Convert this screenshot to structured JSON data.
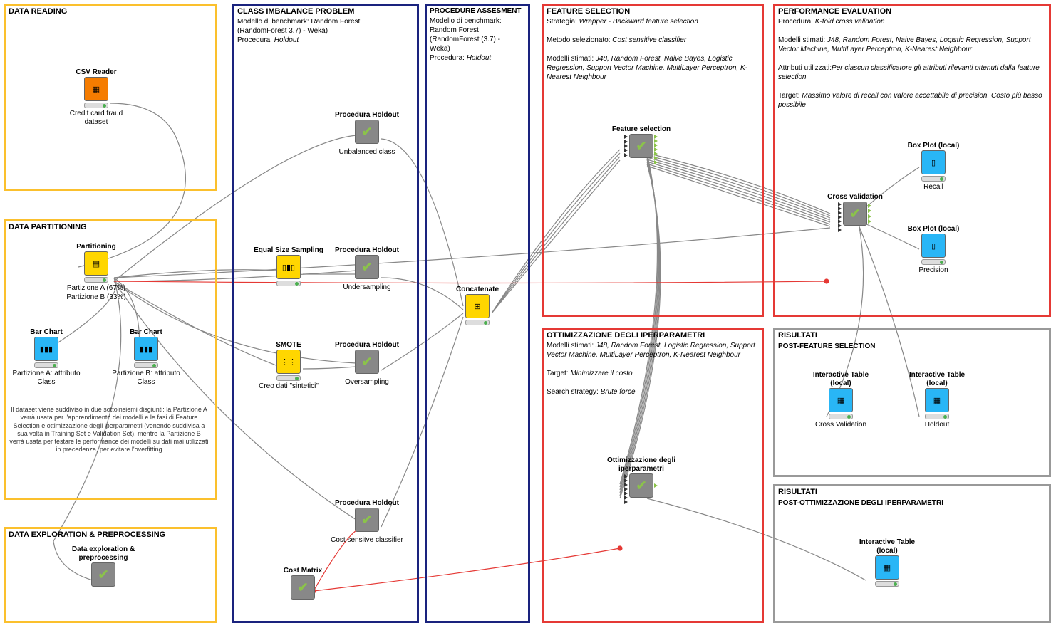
{
  "boxes": {
    "data_reading": {
      "title": "DATA READING"
    },
    "data_partitioning": {
      "title": "DATA PARTITIONING"
    },
    "data_exploration": {
      "title": "DATA EXPLORATION & PREPROCESSING"
    },
    "class_imbalance": {
      "title": "CLASS IMBALANCE PROBLEM",
      "l1": "Modello di benchmark: Random Forest",
      "l2": "(RandomForest 3.7) - Weka)",
      "l3": "Procedura: ",
      "l3i": "Holdout"
    },
    "procedure_assessment": {
      "title": "PROCEDURE ASSESMENT",
      "l1": "Modello di benchmark:",
      "l2": "Random Forest",
      "l3": "(RandomForest (3.7) -",
      "l4": "Weka)",
      "l5": "Procedura: ",
      "l5i": "Holdout"
    },
    "feature_selection": {
      "title": "FEATURE SELECTION",
      "l1": "Strategia: ",
      "l1i": "Wrapper - Backward feature selection",
      "l2": "Metodo selezionato: ",
      "l2i": "Cost sensitive classifier",
      "l3": "Modelli stimati: ",
      "l3i": "J48, Random Forest, Naive Bayes, Logistic Regression, Support Vector Machine, MultiLayer Perceptron, K-Nearest Neighbour"
    },
    "performance_evaluation": {
      "title": "PERFORMANCE EVALUATION",
      "l1": "Procedura: ",
      "l1i": "K-fold cross validation",
      "l2": "Modelli stimati: ",
      "l2i": "J48, Random Forest, Naive Bayes, Logistic Regression, Support Vector Machine, MultiLayer Perceptron, K-Nearest Neighbour",
      "l3": "Attributi utilizzati:",
      "l3i": "Per ciascun classificatore gli attributi rilevanti ottenuti dalla feature selection",
      "l4": "Target: ",
      "l4i": "Massimo valore di recall con valore accettabile di precision. Costo più basso possibile"
    },
    "ottimizzazione": {
      "title": "OTTIMIZZAZIONE DEGLI IPERPARAMETRI",
      "l1": "Modelli stimati: ",
      "l1i": "J48, Random Forest, Logistic Regression, Support Vector Machine, MultiLayer Perceptron, K-Nearest Neighbour",
      "l2": "Target: ",
      "l2i": "Minimizzare il costo",
      "l3": "Search strategy: ",
      "l3i": "Brute force"
    },
    "risultati1": {
      "title": "RISULTATI",
      "sub": "POST-FEATURE SELECTION"
    },
    "risultati2": {
      "title": "RISULTATI",
      "sub": "POST-OTTIMIZZAZIONE DEGLI IPERPARAMETRI"
    }
  },
  "nodes": {
    "csv_reader": {
      "title": "CSV Reader",
      "sub": "Credit card fraud dataset"
    },
    "partitioning": {
      "title": "Partitioning",
      "sub1": "Partizione A (67%)",
      "sub2": "Partizione B (33%)"
    },
    "barA": {
      "title": "Bar Chart",
      "sub": "Partizione A: attributo Class"
    },
    "barB": {
      "title": "Bar Chart",
      "sub": "Partizione B: attributo Class"
    },
    "data_expl": {
      "title": "Data exploration & preprocessing"
    },
    "proc_holdout1": {
      "title": "Procedura Holdout",
      "sub": "Unbalanced class"
    },
    "equal_size": {
      "title": "Equal Size Sampling"
    },
    "proc_holdout2": {
      "title": "Procedura Holdout",
      "sub": "Undersampling"
    },
    "smote": {
      "title": "SMOTE",
      "sub": "Creo dati \"sintetici\""
    },
    "proc_holdout3": {
      "title": "Procedura Holdout",
      "sub": "Oversampling"
    },
    "proc_holdout4": {
      "title": "Procedura Holdout",
      "sub": "Cost sensitve classifier"
    },
    "cost_matrix": {
      "title": "Cost Matrix"
    },
    "concatenate": {
      "title": "Concatenate"
    },
    "feature_sel": {
      "title": "Feature selection"
    },
    "cross_val": {
      "title": "Cross validation"
    },
    "boxplot1": {
      "title": "Box Plot (local)",
      "sub": "Recall"
    },
    "boxplot2": {
      "title": "Box Plot (local)",
      "sub": "Precision"
    },
    "hyper": {
      "title": "Ottimizzazione degli iperparametri"
    },
    "itable1": {
      "title": "Interactive Table (local)",
      "sub": "Cross Validation"
    },
    "itable2": {
      "title": "Interactive Table (local)",
      "sub": "Holdout"
    },
    "itable3": {
      "title": "Interactive Table (local)"
    }
  },
  "partition_desc": "Il dataset viene suddiviso in due sottoinsiemi disgiunti: la Partizione A verrà usata per l'apprendimento dei modelli e le fasi di Feature Selection e ottimizzazione degli iperparametri (venendo suddivisa a sua volta in Training Set e Validation Set), mentre la Partizione B verrà usata per testare le performance dei modelli su dati mai utilizzati in precedenza, per evitare l'overfitting"
}
